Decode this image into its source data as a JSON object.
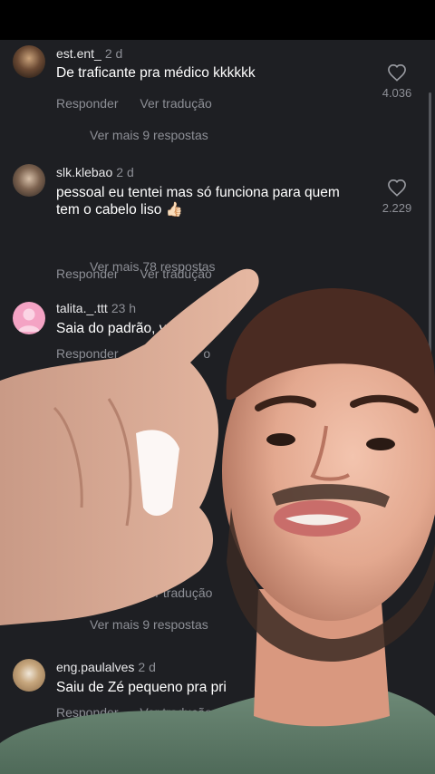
{
  "comments": [
    {
      "username": "est.ent_",
      "age": "2 d",
      "text": "De traficante pra médico kkkkkk",
      "reply": "Responder",
      "translate": "Ver tradução",
      "likes": "4.036",
      "more_replies": "Ver mais 9 respostas"
    },
    {
      "username": "slk.klebao",
      "age": "2 d",
      "text": "pessoal eu tentei mas só funciona para quem tem o cabelo liso 👍🏻",
      "reply": "Responder",
      "translate": "Ver tradução",
      "likes": "2.229",
      "more_replies": "Ver mais 78 respostas"
    },
    {
      "username": "talita._.ttt",
      "age": "23 h",
      "text": "Saia do padrão, v",
      "text_tail": "o!",
      "reply": "Responder",
      "translate_tail": "o"
    },
    {
      "translate": "Ver tradução",
      "more_replies": "Ver mais 9 respostas"
    },
    {
      "username": "eng.paulalves",
      "age": "2 d",
      "text": "Saiu de Zé pequeno pra pri",
      "reply": "Responder",
      "translate": "Ver tradução"
    }
  ],
  "icons": {
    "like": "heart-outline-icon"
  }
}
